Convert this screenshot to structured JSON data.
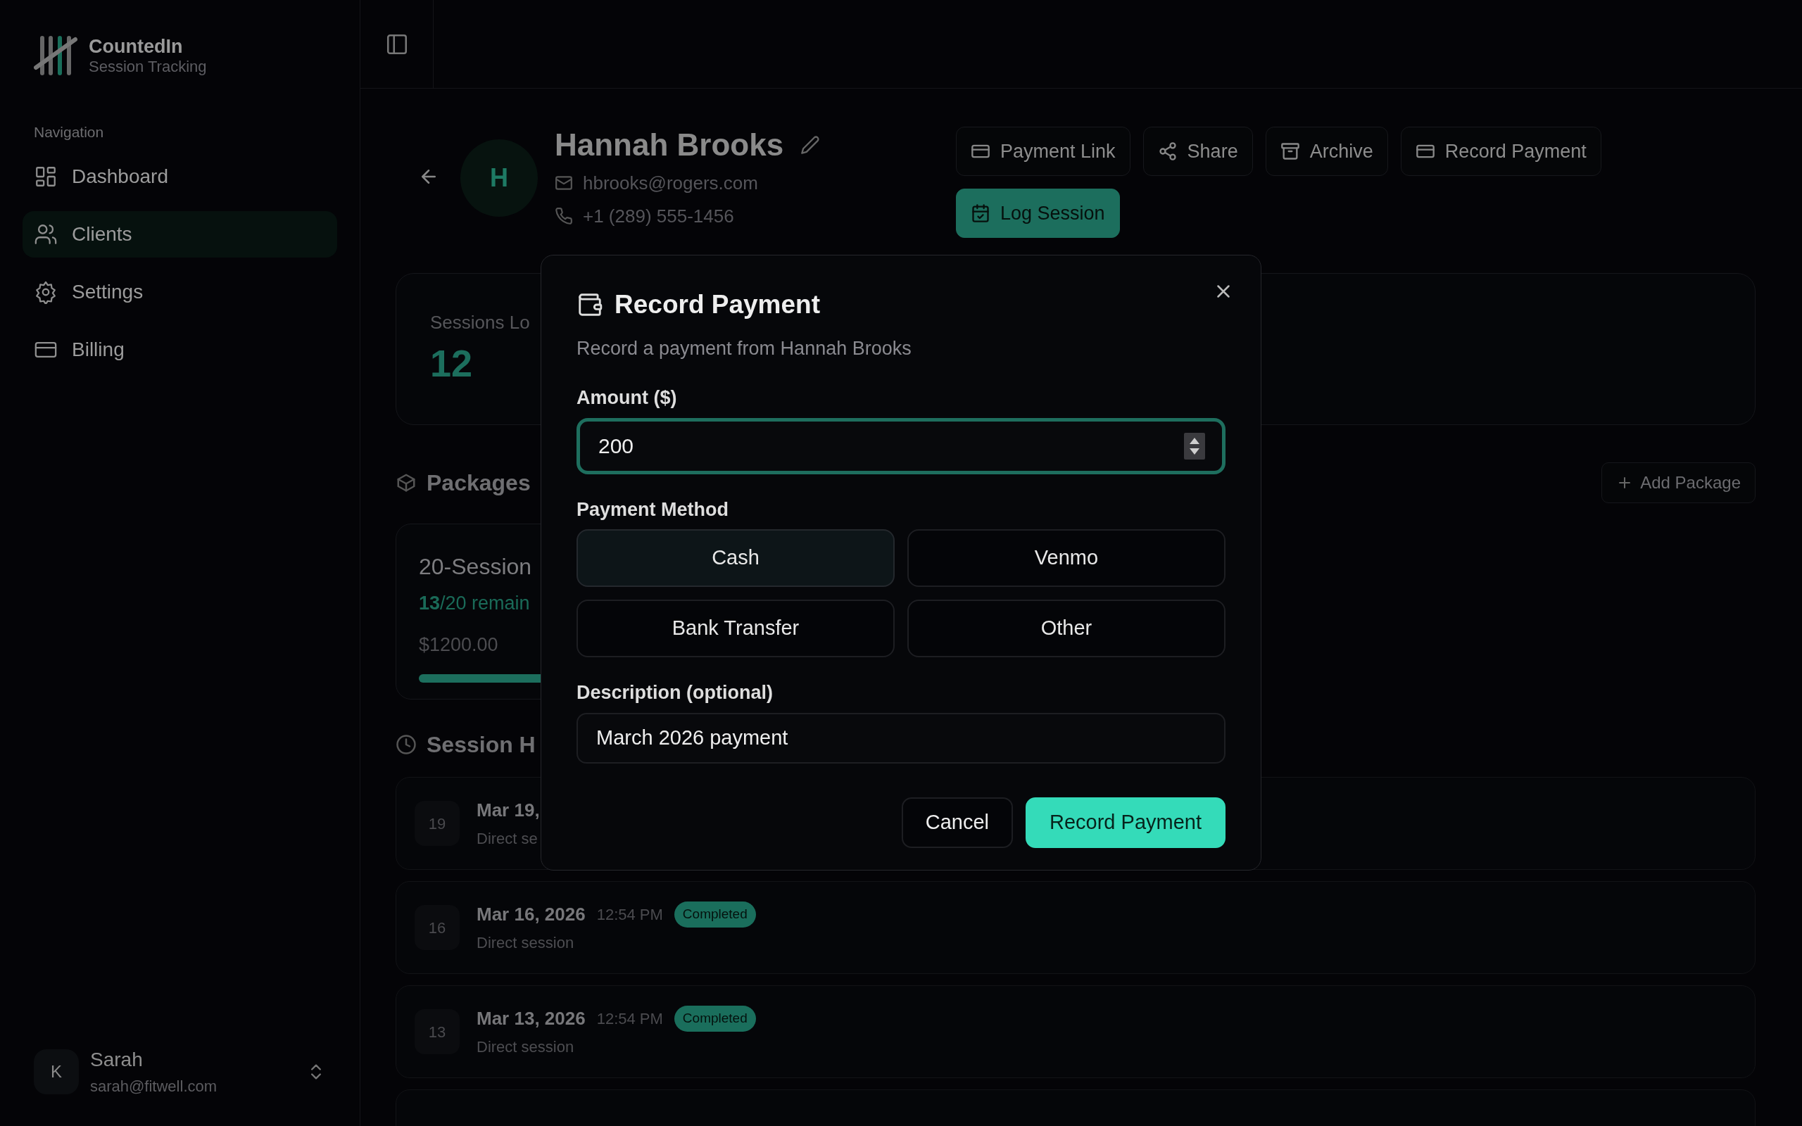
{
  "sidebar": {
    "brand": {
      "name": "CountedIn",
      "tagline": "Session Tracking"
    },
    "section_label": "Navigation",
    "items": [
      {
        "label": "Dashboard",
        "selected": false
      },
      {
        "label": "Clients",
        "selected": true
      },
      {
        "label": "Settings",
        "selected": false
      },
      {
        "label": "Billing",
        "selected": false
      }
    ],
    "user": {
      "initial": "K",
      "name": "Sarah",
      "email": "sarah@fitwell.com"
    }
  },
  "client": {
    "initial": "H",
    "name": "Hannah Brooks",
    "email": "hbrooks@rogers.com",
    "phone": "+1 (289) 555-1456"
  },
  "actions": [
    {
      "label": "Payment Link",
      "kind": "outline"
    },
    {
      "label": "Share",
      "kind": "outline"
    },
    {
      "label": "Archive",
      "kind": "outline"
    },
    {
      "label": "Record Payment",
      "kind": "outline"
    },
    {
      "label": "Log Session",
      "kind": "primary"
    }
  ],
  "stats": {
    "label": "Sessions Lo",
    "value": "12"
  },
  "packages": {
    "title": "Packages",
    "add_button": "Add Package",
    "items": [
      {
        "name": "20-Session",
        "remaining": "**13**/20 remain",
        "price": "$1200.00",
        "level": 0.65
      }
    ]
  },
  "history": {
    "title": "Session H",
    "rows": [
      {
        "kind": "partial",
        "day": "19",
        "date": "Mar 19,",
        "note": "Direct se"
      },
      {
        "kind": "full",
        "day": "16",
        "date": "Mar 16, 2026",
        "time": "12:54 PM",
        "status": "Completed",
        "note": "Direct session"
      },
      {
        "kind": "full",
        "day": "13",
        "date": "Mar 13, 2026",
        "time": "12:54 PM",
        "status": "Completed",
        "note": "Direct session"
      },
      {
        "kind": "cut"
      }
    ]
  },
  "dialog": {
    "title": "Record Payment",
    "subtitle": "Record a payment from Hannah Brooks",
    "amount": {
      "label": "Amount ($)",
      "value": "200",
      "focused": true
    },
    "method": {
      "label": "Payment Method",
      "options": [
        {
          "label": "Cash",
          "selected": true
        },
        {
          "label": "Venmo",
          "selected": false
        },
        {
          "label": "Bank Transfer",
          "selected": false
        },
        {
          "label": "Other",
          "selected": false
        }
      ]
    },
    "description": {
      "label": "Description (optional)",
      "value": "March 2026 payment"
    },
    "buttons": [
      {
        "label": "Cancel",
        "kind": "secondary"
      },
      {
        "label": "Record Payment",
        "kind": "primary"
      }
    ]
  }
}
